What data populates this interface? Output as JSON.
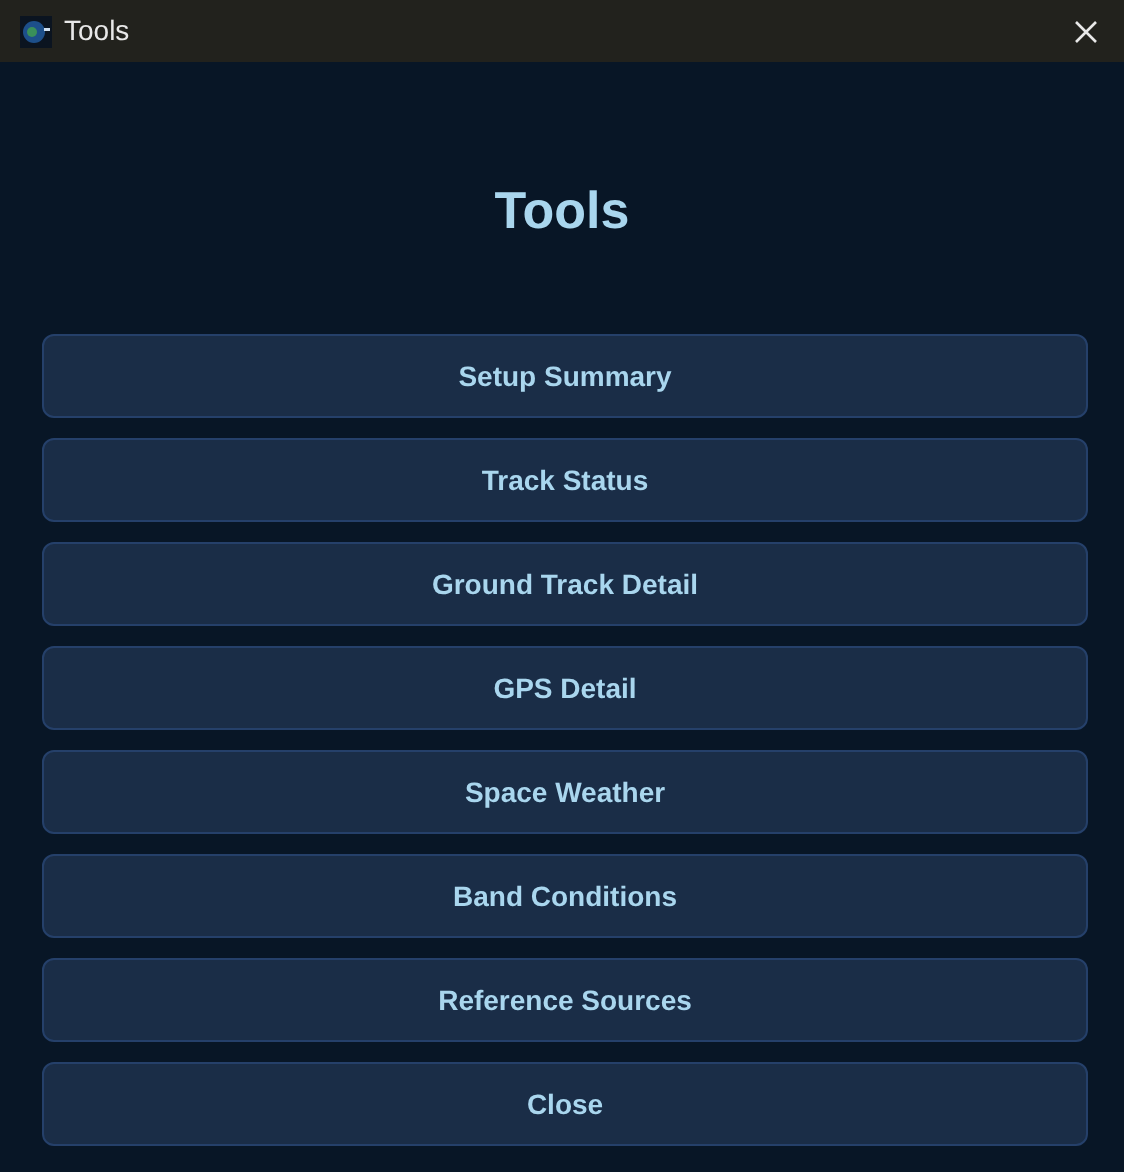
{
  "window": {
    "title": "Tools"
  },
  "heading": "Tools",
  "buttons": [
    {
      "label": "Setup Summary"
    },
    {
      "label": "Track Status"
    },
    {
      "label": "Ground Track Detail"
    },
    {
      "label": "GPS Detail"
    },
    {
      "label": "Space Weather"
    },
    {
      "label": "Band Conditions"
    },
    {
      "label": "Reference Sources"
    },
    {
      "label": "Close"
    }
  ]
}
